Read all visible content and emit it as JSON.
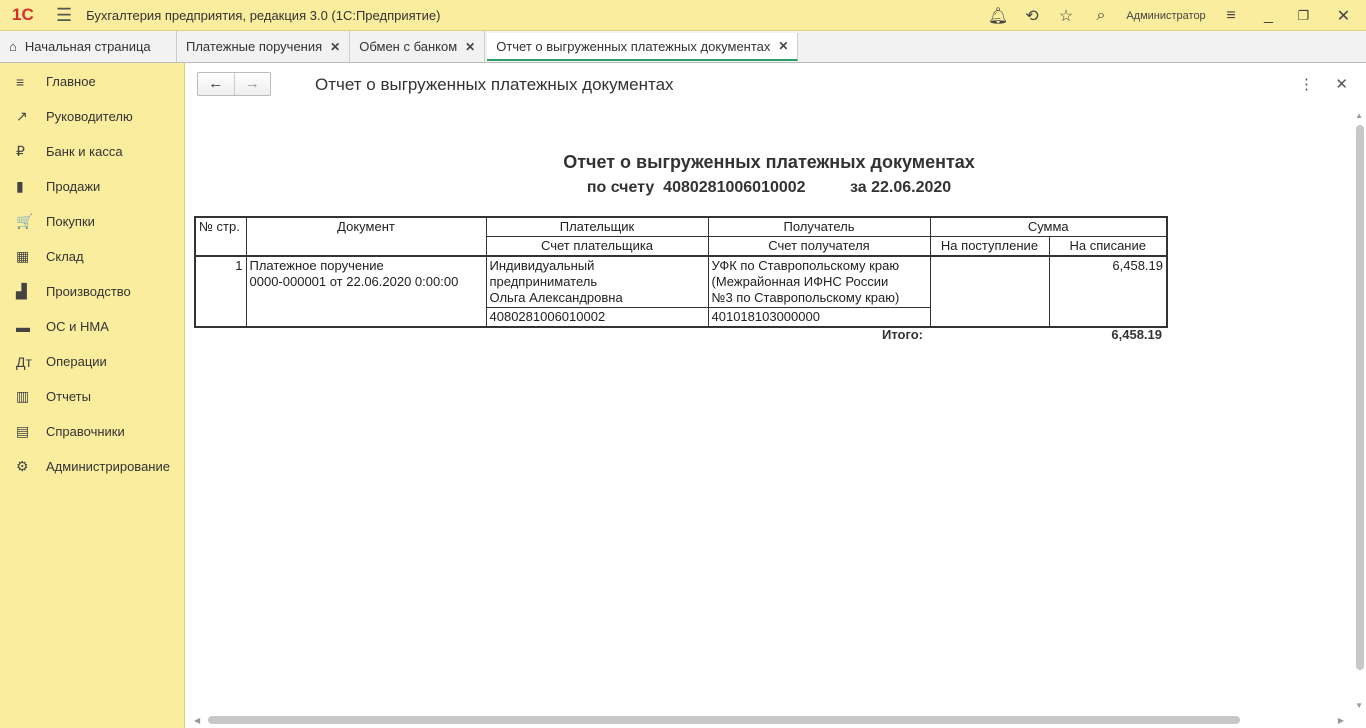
{
  "app": {
    "logo": "1С",
    "title": "Бухгалтерия предприятия, редакция 3.0  (1С:Предприятие)",
    "user": "Администратор"
  },
  "tabs": [
    {
      "label": "Начальная страница"
    },
    {
      "label": "Платежные поручения"
    },
    {
      "label": "Обмен с банком"
    },
    {
      "label": "Отчет о выгруженных платежных документах"
    }
  ],
  "sidebar": [
    {
      "icon": "≡",
      "label": "Главное"
    },
    {
      "icon": "↗",
      "label": "Руководителю"
    },
    {
      "icon": "₽",
      "label": "Банк и касса"
    },
    {
      "icon": "▮",
      "label": "Продажи"
    },
    {
      "icon": "🛒",
      "label": "Покупки"
    },
    {
      "icon": "▦",
      "label": "Склад"
    },
    {
      "icon": "▟",
      "label": "Производство"
    },
    {
      "icon": "▬",
      "label": "ОС и НМА"
    },
    {
      "icon": "Дт",
      "label": "Операции"
    },
    {
      "icon": "▥",
      "label": "Отчеты"
    },
    {
      "icon": "▤",
      "label": "Справочники"
    },
    {
      "icon": "⚙",
      "label": "Администрирование"
    }
  ],
  "form": {
    "title": "Отчет о выгруженных платежных документах"
  },
  "report": {
    "title": "Отчет о выгруженных платежных документах",
    "subtitle": "по счету  4080281006010002          за 22.06.2020",
    "headers": {
      "num": "№ стр.",
      "doc": "Документ",
      "payer": "Плательщик",
      "payer_acc": "Счет плательщика",
      "recipient": "Получатель",
      "recipient_acc": "Счет получателя",
      "sum": "Сумма",
      "income": "На поступление",
      "outcome": "На списание"
    },
    "rows": [
      {
        "num": "1",
        "doc1": "Платежное поручение",
        "doc2": "0000-000001 от 22.06.2020 0:00:00",
        "payer1": "Индивидуальный",
        "payer2": "предприниматель",
        "payer3": "Ольга Александровна",
        "payer_acc": "4080281006010002",
        "rec1": "УФК по Ставропольскому краю",
        "rec2": "(Межрайонная ИФНС России",
        "rec3": "№3 по Ставропольскому краю)",
        "rec_acc": "401018103000000",
        "income": "",
        "outcome": "6,458.19"
      }
    ],
    "total_label": "Итого:",
    "total": "6,458.19"
  }
}
